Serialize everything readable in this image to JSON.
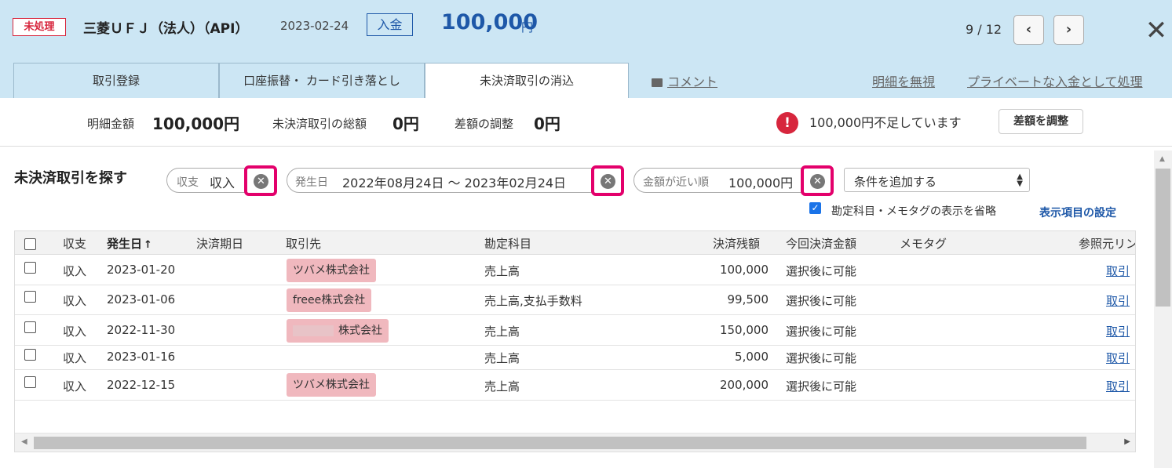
{
  "header": {
    "status_badge": "未処理",
    "bank_name": "三菱ＵＦＪ（法人）（API）",
    "date": "2023-02-24",
    "type": "入金",
    "amount": "100,000",
    "amount_unit": "円",
    "pager": "9 / 12",
    "prev_label": "‹",
    "next_label": "›",
    "close_label": "✕"
  },
  "tabs": [
    {
      "label": "取引登録"
    },
    {
      "label": "口座振替・ カード引き落とし"
    },
    {
      "label": "未決済取引の消込"
    }
  ],
  "header_links": {
    "comment": "コメント",
    "ignore": "明細を無視",
    "private": "プライベートな入金として処理"
  },
  "summary": {
    "detail_label": "明細金額",
    "detail_value": "100,000円",
    "unsettled_label": "未決済取引の総額",
    "unsettled_value": "0円",
    "diff_label": "差額の調整",
    "diff_value": "0円",
    "warning": "100,000円不足しています",
    "adjust_button": "差額を調整"
  },
  "search": {
    "title": "未決済取引を探す",
    "chips": [
      {
        "label": "収支",
        "value": "収入"
      },
      {
        "label": "発生日",
        "value": "2022年08月24日 〜 2023年02月24日"
      },
      {
        "label": "金額が近い順",
        "value": "100,000円"
      }
    ],
    "add_condition": "条件を追加する",
    "omit_label": "勘定科目・メモタグの表示を省略",
    "display_settings": "表示項目の設定"
  },
  "table": {
    "headers": {
      "type": "収支",
      "date": "発生日",
      "date_sort": "↑",
      "due": "決済期日",
      "partner": "取引先",
      "account": "勘定科目",
      "balance": "決済残額",
      "current": "今回決済金額",
      "memo": "メモタグ",
      "ref": "参照元リン"
    },
    "rows": [
      {
        "type": "収入",
        "date": "2023-01-20",
        "partner": "ツバメ株式会社",
        "account": "売上高",
        "balance": "100,000",
        "current": "選択後に可能",
        "ref": "取引"
      },
      {
        "type": "収入",
        "date": "2023-01-06",
        "partner": "freee株式会社",
        "account": "売上高,支払手数料",
        "balance": "99,500",
        "current": "選択後に可能",
        "ref": "取引"
      },
      {
        "type": "収入",
        "date": "2022-11-30",
        "partner": "株式会社",
        "account": "売上高",
        "balance": "150,000",
        "current": "選択後に可能",
        "ref": "取引"
      },
      {
        "type": "収入",
        "date": "2023-01-16",
        "partner": "",
        "account": "売上高",
        "balance": "5,000",
        "current": "選択後に可能",
        "ref": "取引"
      },
      {
        "type": "収入",
        "date": "2022-12-15",
        "partner": "ツバメ株式会社",
        "account": "売上高",
        "balance": "200,000",
        "current": "選択後に可能",
        "ref": "取引"
      }
    ]
  }
}
